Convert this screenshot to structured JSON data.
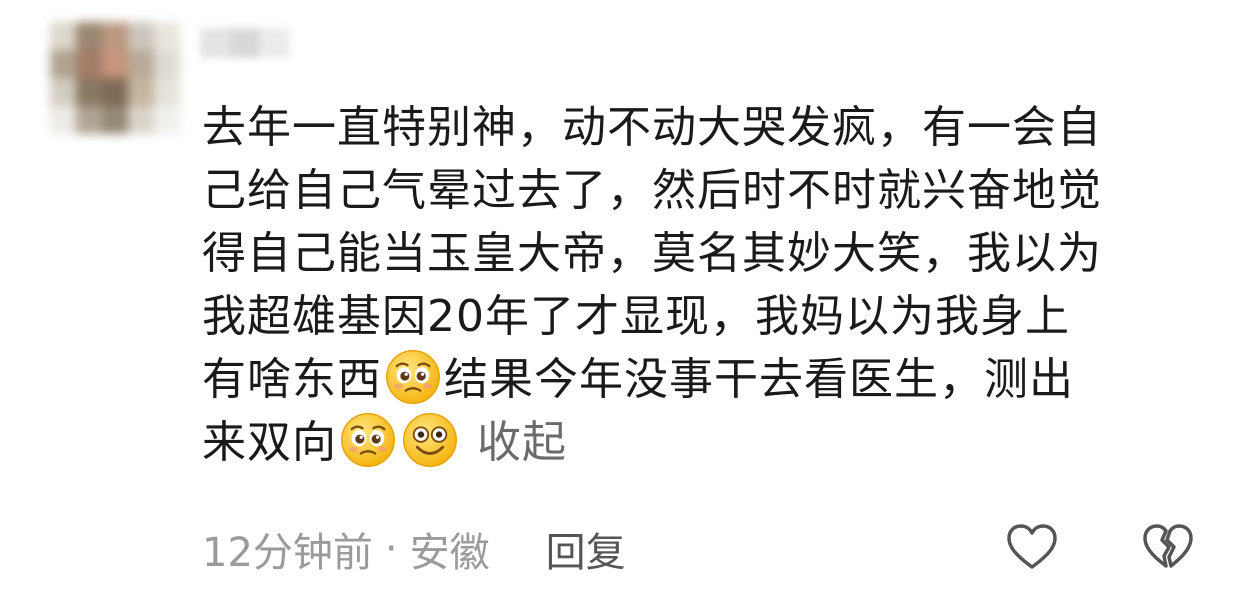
{
  "comment": {
    "lines": [
      "去年一直特别神，动不动大哭发疯，有一会自",
      "己给自己气晕过去了，然后时不时就兴奋地觉",
      "得自己能当玉皇大帝，莫名其妙大笑，我以为",
      "我超雄基因20年了才显现，我妈以为我身上"
    ],
    "line5_before_emoji": "有啥东西",
    "line5_after_emoji": "结果今年没事干去看医生，测出",
    "line6_text": "来双向",
    "collapse_label": "收起",
    "emojis": [
      "pleading-face-emoji",
      "pleading-face-emoji",
      "wide-eyed-smile-emoji"
    ]
  },
  "meta": {
    "time": "12分钟前",
    "separator": "·",
    "location": "安徽",
    "reply_label": "回复"
  },
  "icons": {
    "like": "heart-outline-icon",
    "dislike": "broken-heart-outline-icon"
  }
}
